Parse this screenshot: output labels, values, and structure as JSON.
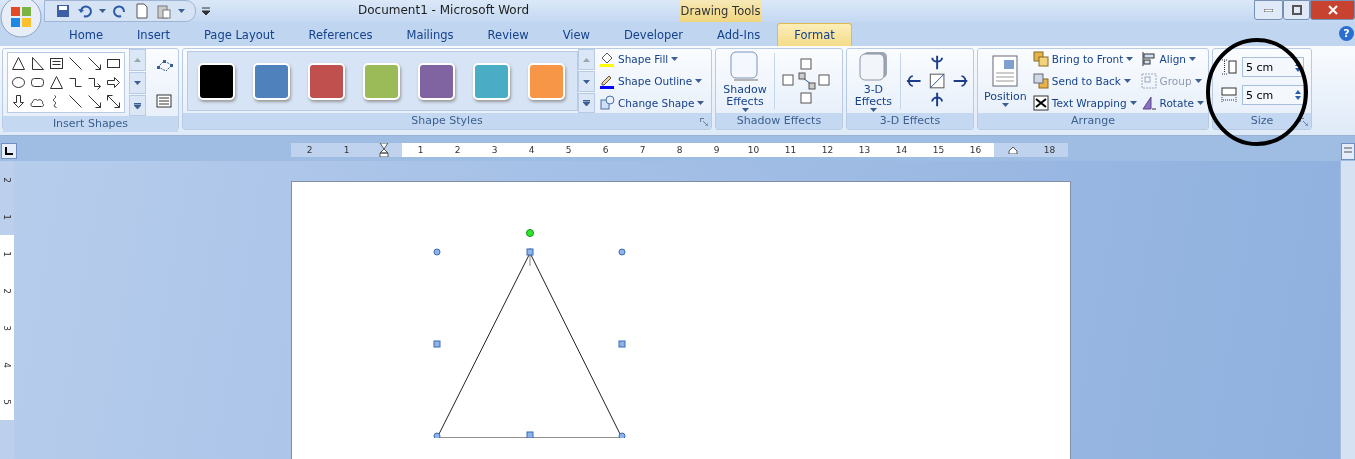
{
  "title_bar": {
    "document_title": "Document1 - Microsoft Word",
    "contextual_group": "Drawing Tools"
  },
  "tabs": [
    {
      "label": "Home",
      "selected": false
    },
    {
      "label": "Insert",
      "selected": false
    },
    {
      "label": "Page Layout",
      "selected": false
    },
    {
      "label": "References",
      "selected": false
    },
    {
      "label": "Mailings",
      "selected": false
    },
    {
      "label": "Review",
      "selected": false
    },
    {
      "label": "View",
      "selected": false
    },
    {
      "label": "Developer",
      "selected": false
    },
    {
      "label": "Add-Ins",
      "selected": false
    },
    {
      "label": "Format",
      "selected": true
    }
  ],
  "help_button": "?",
  "insert_shapes": {
    "label": "Insert Shapes"
  },
  "shape_styles": {
    "label": "Shape Styles",
    "swatches": [
      {
        "color": "#000000"
      },
      {
        "color": "#4f81bd"
      },
      {
        "color": "#c0504d"
      },
      {
        "color": "#9bbb59"
      },
      {
        "color": "#8064a2"
      },
      {
        "color": "#4bacc6"
      },
      {
        "color": "#f79646"
      }
    ],
    "commands": [
      {
        "kind": "fill",
        "label": "Shape Fill"
      },
      {
        "kind": "outline",
        "label": "Shape Outline"
      },
      {
        "kind": "change",
        "label": "Change Shape"
      }
    ]
  },
  "shadow_effects": {
    "button": "Shadow Effects",
    "label": "Shadow Effects"
  },
  "three_d_effects": {
    "button": "3-D Effects",
    "label": "3-D Effects"
  },
  "arrange": {
    "position": "Position",
    "label": "Arrange",
    "commands": [
      {
        "kind": "front",
        "label": "Bring to Front",
        "disabled": false
      },
      {
        "kind": "back",
        "label": "Send to Back",
        "disabled": false
      },
      {
        "kind": "wrap",
        "label": "Text Wrapping",
        "disabled": false
      },
      {
        "kind": "align",
        "label": "Align",
        "disabled": false
      },
      {
        "kind": "group",
        "label": "Group",
        "disabled": true
      },
      {
        "kind": "rotate",
        "label": "Rotate",
        "disabled": false
      }
    ]
  },
  "size": {
    "label": "Size",
    "height": "5 cm",
    "width": "5 cm"
  },
  "ruler": {
    "left_labels": [
      "2",
      "1"
    ],
    "body_labels": [
      "1",
      "2",
      "3",
      "4",
      "5",
      "6",
      "7",
      "8",
      "9",
      "10",
      "11",
      "12",
      "13",
      "14",
      "15",
      "16"
    ],
    "right_labels": [
      "18"
    ]
  },
  "vertical_ruler": {
    "top_labels": [
      "2",
      "1"
    ],
    "body_labels": [
      "1",
      "2",
      "3",
      "4",
      "5"
    ]
  }
}
